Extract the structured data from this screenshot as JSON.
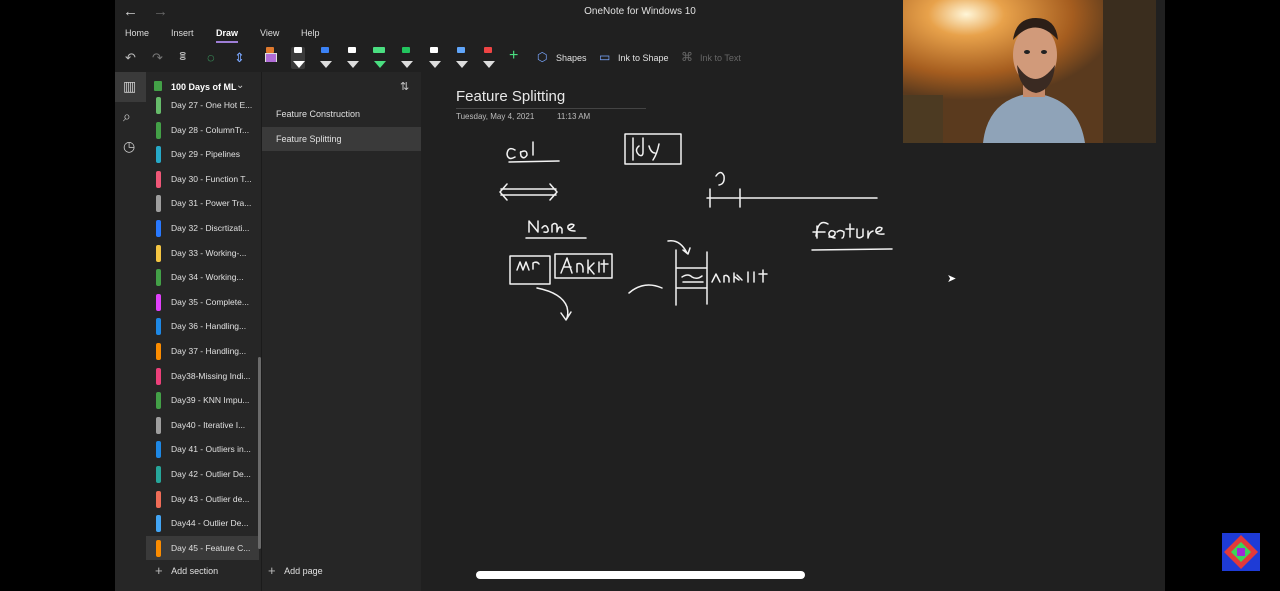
{
  "window": {
    "title": "OneNote for Windows 10"
  },
  "menu": [
    "Home",
    "Insert",
    "Draw",
    "View",
    "Help"
  ],
  "toolbar": {
    "shapes": "Shapes",
    "ink_to_shape": "Ink to Shape",
    "ink_to_text": "Ink to Text",
    "pen_colors": [
      "#e07a2e",
      "#ffffff",
      "#3b82f6",
      "#4ade80",
      "#22c55e",
      "#ffffff",
      "#60a5fa",
      "#ef4444"
    ]
  },
  "notebook": {
    "name": "100 Days of ML"
  },
  "sections": [
    {
      "label": "Day 27 - One Hot E...",
      "color": "#66bb6a"
    },
    {
      "label": "Day 28 - ColumnTr...",
      "color": "#43a047"
    },
    {
      "label": "Day 29 - Pipelines",
      "color": "#26a9c8"
    },
    {
      "label": "Day 30 - Function T...",
      "color": "#ef5777"
    },
    {
      "label": "Day 31 - Power Tra...",
      "color": "#9e9e9e"
    },
    {
      "label": "Day 32 - Discrtizati...",
      "color": "#2979ff"
    },
    {
      "label": "Day 33 - Working-...",
      "color": "#f4c542"
    },
    {
      "label": "Day 34 - Working...",
      "color": "#43a047"
    },
    {
      "label": "Day 35 - Complete...",
      "color": "#e040fb"
    },
    {
      "label": "Day 36 - Handling...",
      "color": "#1e88e5"
    },
    {
      "label": "Day 37 - Handling...",
      "color": "#fb8c00"
    },
    {
      "label": "Day38-Missing Indi...",
      "color": "#ec407a"
    },
    {
      "label": "Day39 - KNN Impu...",
      "color": "#43a047"
    },
    {
      "label": "Day40 - Iterative I...",
      "color": "#9e9e9e"
    },
    {
      "label": "Day 41 - Outliers in...",
      "color": "#1e88e5"
    },
    {
      "label": "Day 42 - Outlier De...",
      "color": "#26a69a"
    },
    {
      "label": "Day 43 - Outlier de...",
      "color": "#ef6c57"
    },
    {
      "label": "Day44 - Outlier De...",
      "color": "#42a5f5"
    },
    {
      "label": "Day 45 - Feature C...",
      "color": "#fb8c00"
    }
  ],
  "pages": [
    "Feature Construction",
    "Feature Splitting"
  ],
  "add_section": "Add section",
  "add_page": "Add page",
  "note": {
    "title": "Feature Splitting",
    "date": "Tuesday, May 4, 2021",
    "time": "11:13 AM"
  }
}
